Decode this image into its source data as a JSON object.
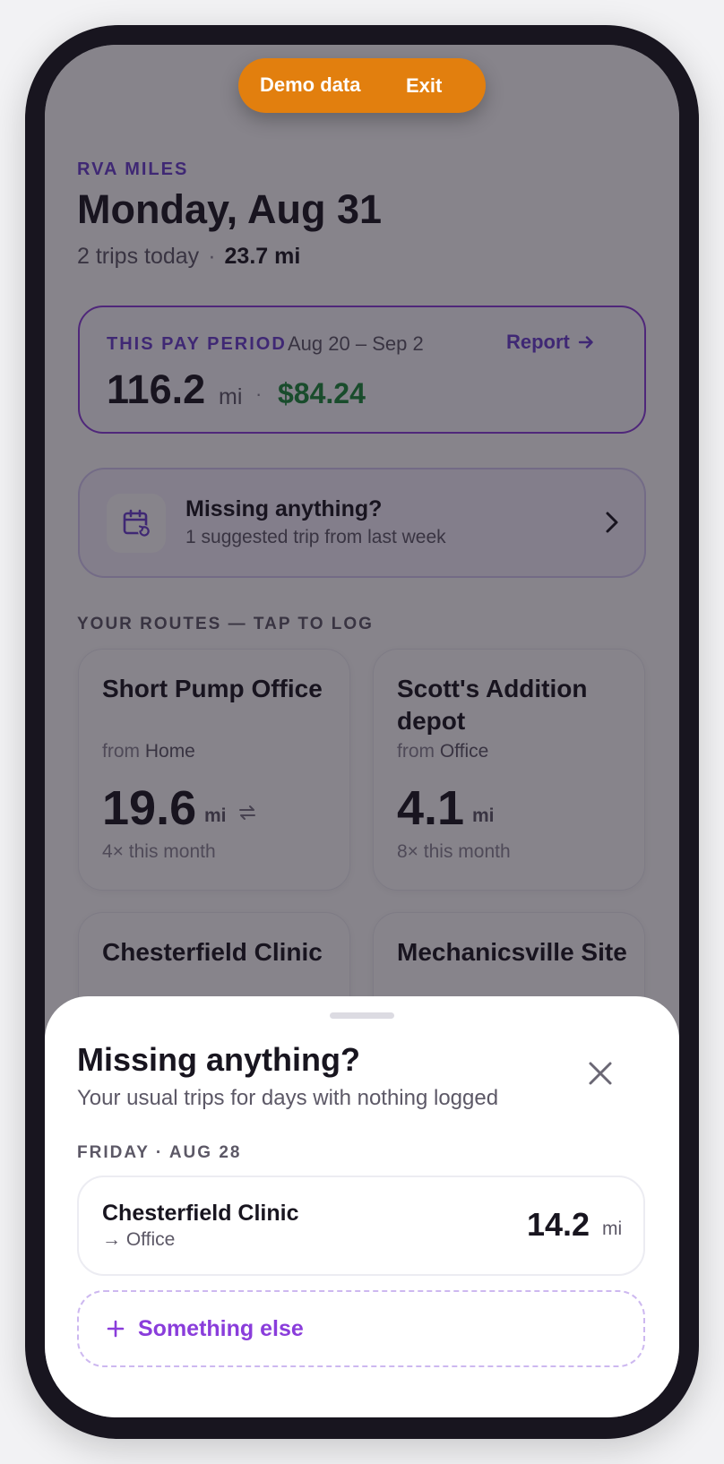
{
  "banner": {
    "label": "Demo data",
    "exit_label": "Exit",
    "color": "#e27f0e"
  },
  "header": {
    "app_name": "RVA MILES",
    "date": "Monday, Aug 31",
    "trips_today": "2 trips today",
    "separator": "·",
    "miles_today": "23.7 mi"
  },
  "pay_period": {
    "label": "THIS PAY PERIOD",
    "range": "Aug 20 – Sep 2",
    "report_label": "Report",
    "miles": "116.2",
    "unit": "mi",
    "separator": "·",
    "amount": "$84.24",
    "amount_color": "#1a8a3a",
    "accent": "#8a3ddb"
  },
  "missing_card": {
    "icon": "calendar-clock-icon",
    "title": "Missing anything?",
    "subtitle": "1 suggested trip from last week"
  },
  "routes": {
    "label": "YOUR ROUTES — TAP TO LOG",
    "items": [
      {
        "name": "Short Pump Office",
        "from_prefix": "from",
        "from": "Home",
        "miles": "19.6",
        "unit": "mi",
        "round_trip": true,
        "count": "4× this month"
      },
      {
        "name": "Scott's Addition depot",
        "from_prefix": "from",
        "from": "Office",
        "miles": "4.1",
        "unit": "mi",
        "round_trip": false,
        "count": "8× this month"
      },
      {
        "name": "Chesterfield Clinic"
      },
      {
        "name": "Mechanicsville Site"
      }
    ]
  },
  "sheet": {
    "title": "Missing anything?",
    "subtitle": "Your usual trips for days with nothing logged",
    "day_label": "FRIDAY · AUG 28",
    "trip": {
      "name": "Chesterfield Clinic",
      "dest": "→ Office",
      "miles": "14.2",
      "unit": "mi"
    },
    "something_else": "Something else"
  }
}
